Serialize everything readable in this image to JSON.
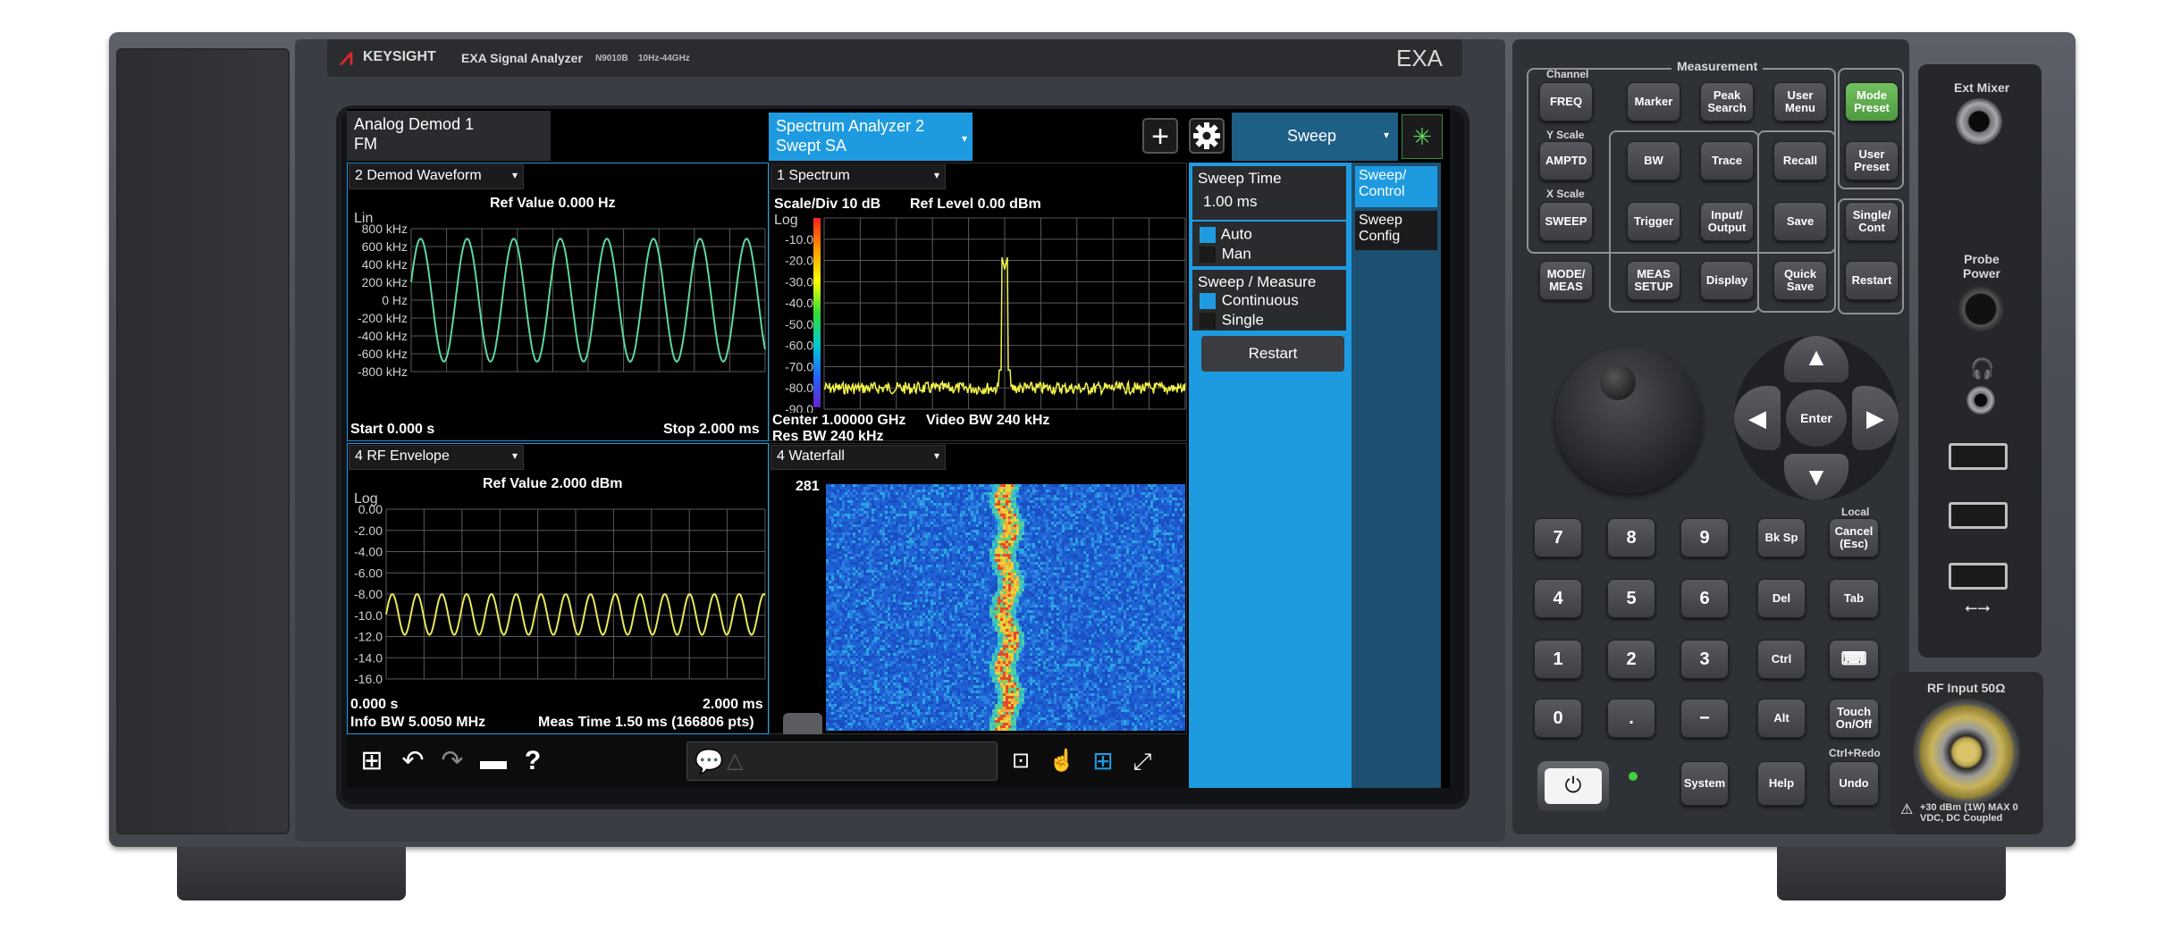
{
  "instrument": {
    "brand": "KEYSIGHT",
    "model": "EXA Signal Analyzer",
    "model_no": "N9010B",
    "freq_range": "10Hz-44GHz",
    "badge": "EXA"
  },
  "tabs": [
    {
      "title": "Analog Demod 1",
      "sub": "FM"
    },
    {
      "title": "Spectrum Analyzer 2",
      "sub": "Swept SA"
    }
  ],
  "toolbar": {
    "add": "+",
    "settings": "gear-icon",
    "menu_title": "Sweep"
  },
  "windows": {
    "demod": {
      "selector": "2 Demod Waveform",
      "ref": "Ref Value 0.000 Hz",
      "scale": "Lin",
      "ticks": [
        "800 kHz",
        "600 kHz",
        "400 kHz",
        "200 kHz",
        "0 Hz",
        "-200 kHz",
        "-400 kHz",
        "-600 kHz",
        "-800 kHz"
      ],
      "start": "Start 0.000 s",
      "stop": "Stop 2.000 ms",
      "color": "#5fd6a0"
    },
    "envelope": {
      "selector": "4 RF Envelope",
      "ref": "Ref Value 2.000 dBm",
      "scale": "Log",
      "ticks": [
        "0.00",
        "-2.00",
        "-4.00",
        "-6.00",
        "-8.00",
        "-10.0",
        "-12.0",
        "-14.0",
        "-16.0"
      ],
      "start": "0.000 s",
      "stop": "2.000 ms",
      "info_bw": "Info BW 5.0050 MHz",
      "meas_time": "Meas Time 1.50 ms (166806 pts)",
      "color": "#e8e85a"
    },
    "spectrum": {
      "selector": "1 Spectrum",
      "scale_div": "Scale/Div 10 dB",
      "ref_level": "Ref Level 0.00 dBm",
      "scale": "Log",
      "ticks": [
        "-10.0",
        "-20.0",
        "-30.0",
        "-40.0",
        "-50.0",
        "-60.0",
        "-70.0",
        "-80.0",
        "-90.0"
      ],
      "center": "Center 1.00000 GHz",
      "video_bw": "Video BW 240 kHz",
      "res_bw": "Res BW 240 kHz",
      "color": "#f2f24a"
    },
    "waterfall": {
      "selector": "4 Waterfall",
      "count": "281"
    }
  },
  "sweep_menu": {
    "sweep_time_label": "Sweep Time",
    "sweep_time_value": "1.00 ms",
    "auto": "Auto",
    "man": "Man",
    "sweep_measure_label": "Sweep / Measure",
    "continuous": "Continuous",
    "single": "Single",
    "restart": "Restart",
    "tabs": [
      "Sweep/ Control",
      "Sweep Config"
    ]
  },
  "front_panel": {
    "measurement_label": "Measurement",
    "channel_label": "Channel",
    "yscale_label": "Y Scale",
    "xscale_label": "X Scale",
    "keys": {
      "freq": "FREQ",
      "marker": "Marker",
      "peak": "Peak Search",
      "user_menu": "User Menu",
      "mode_preset": "Mode Preset",
      "amptd": "AMPTD",
      "bw": "BW",
      "trace": "Trace",
      "recall": "Recall",
      "user_preset": "User Preset",
      "sweep": "SWEEP",
      "trigger": "Trigger",
      "input_output": "Input/ Output",
      "save": "Save",
      "single_cont": "Single/ Cont",
      "mode_meas": "MODE/ MEAS",
      "meas_setup": "MEAS SETUP",
      "display": "Display",
      "quick_save": "Quick Save",
      "restart": "Restart",
      "enter": "Enter",
      "bksp": "Bk Sp",
      "local": "Local",
      "cancel": "Cancel (Esc)",
      "del": "Del",
      "tab": "Tab",
      "ctrl": "Ctrl",
      "alt": "Alt",
      "touch": "Touch On/Off",
      "system": "System",
      "help": "Help",
      "ctrl_redo": "Ctrl+Redo",
      "undo": "Undo"
    },
    "numpad": [
      "7",
      "8",
      "9",
      "4",
      "5",
      "6",
      "1",
      "2",
      "3",
      "0",
      ".",
      "−"
    ],
    "ext_mixer": "Ext Mixer",
    "probe_power": "Probe Power",
    "rf_input": "RF Input 50Ω",
    "rf_warning": "+30 dBm (1W) MAX 0 VDC, DC Coupled"
  }
}
